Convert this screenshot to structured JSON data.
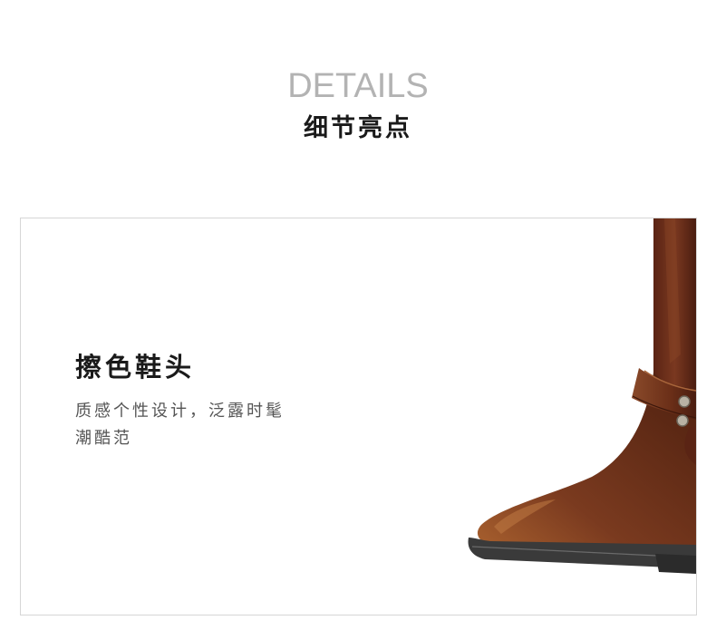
{
  "header": {
    "title_en": "DETAILS",
    "title_cn": "细节亮点"
  },
  "feature": {
    "title": "擦色鞋头",
    "desc_line1": "质感个性设计，泛露时髦",
    "desc_line2": "潮酷范"
  },
  "image": {
    "subject": "brown-leather-boot-toe",
    "colors": {
      "leather": "#6b2f1a",
      "leather_highlight": "#a0532f",
      "sole": "#3a3a3a",
      "stud": "#b9b2a4"
    }
  }
}
